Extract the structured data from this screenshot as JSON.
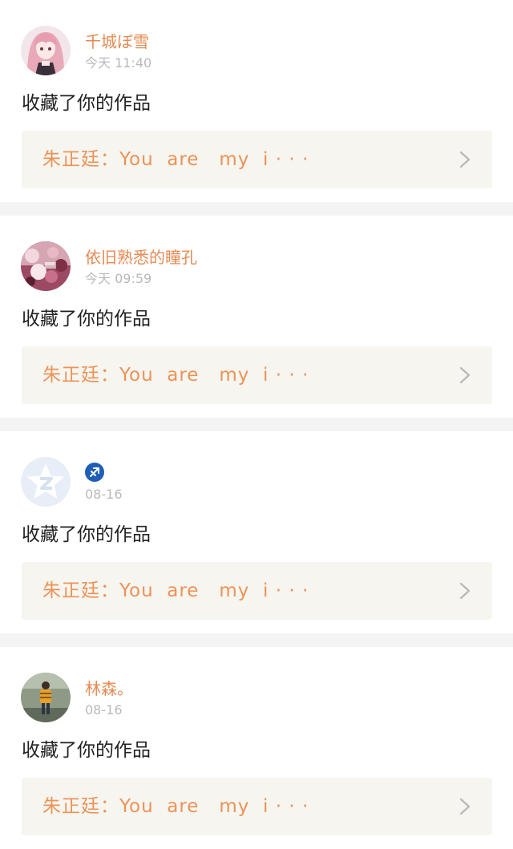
{
  "colors": {
    "name": "#e58b55",
    "time": "#b9b9b9",
    "action_text": "#222222",
    "ref_text": "#ec9358",
    "ref_bg": "#f6f5ef",
    "separator": "#f4f4f4",
    "zodiac_badge": "#1f5fb5"
  },
  "items": [
    {
      "username": "千城ぼ雪",
      "time": "今天 11:40",
      "action": "收藏了你的作品",
      "ref_text": "朱正廷：You  are   my  i · · ·",
      "avatar_icon": "anime-girl-avatar"
    },
    {
      "username": "依旧熟悉的瞳孔",
      "time": "今天 09:59",
      "action": "收藏了你的作品",
      "ref_text": "朱正廷：You  are   my  i · · ·",
      "avatar_icon": "floral-photo-avatar"
    },
    {
      "username": "",
      "time": "08-16",
      "action": "收藏了你的作品",
      "ref_text": "朱正廷：You  are   my  i · · ·",
      "avatar_icon": "default-qzone-star-avatar",
      "badge_icon": "sagittarius-icon"
    },
    {
      "username": "林森。",
      "time": "08-16",
      "action": "收藏了你的作品",
      "ref_text": "朱正廷：You  are   my  i · · ·",
      "avatar_icon": "person-photo-avatar"
    }
  ]
}
